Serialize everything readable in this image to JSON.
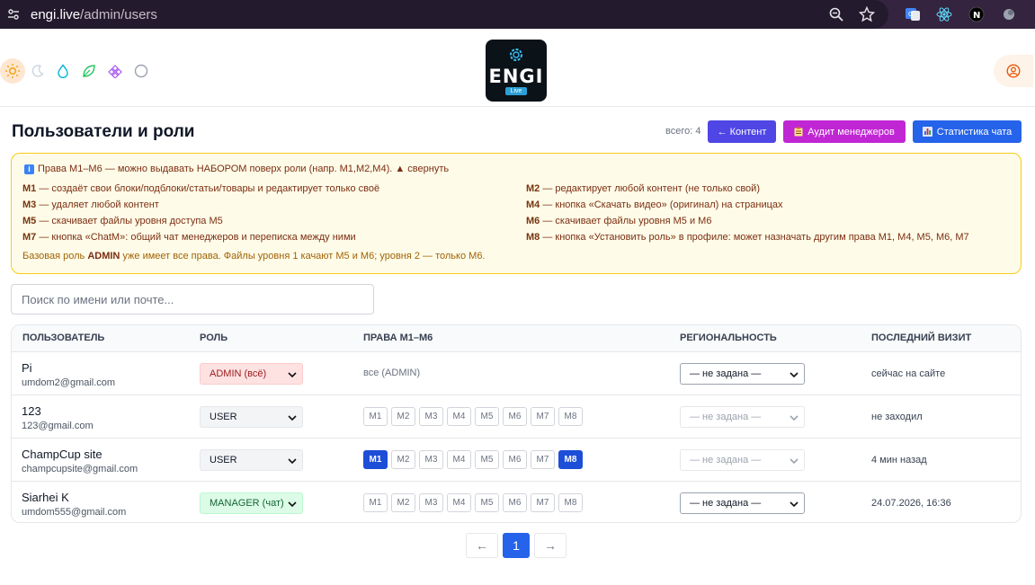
{
  "browser": {
    "url_host": "engi.live",
    "url_path": "/admin/users"
  },
  "logo": {
    "text": "ENGI",
    "sub": "Live"
  },
  "page": {
    "title": "Пользователи и роли",
    "total": "всего: 4",
    "buttons": {
      "content": "← Контент",
      "audit": "Аудит менеджеров",
      "stats": "Статистика чата"
    }
  },
  "info": {
    "header": "Права M1–M6 — можно выдавать НАБОРОМ поверх роли (напр. M1,M2,M4). ▲ свернуть",
    "perms": [
      {
        "code": "M1",
        "text": " — создаёт свои блоки/подблоки/статьи/товары и редактирует только своё"
      },
      {
        "code": "M2",
        "text": " — редактирует любой контент (не только свой)"
      },
      {
        "code": "M3",
        "text": " — удаляет любой контент"
      },
      {
        "code": "M4",
        "text": " — кнопка «Скачать видео» (оригинал) на страницах"
      },
      {
        "code": "M5",
        "text": " — скачивает файлы уровня доступа M5"
      },
      {
        "code": "M6",
        "text": " — скачивает файлы уровня M5 и M6"
      },
      {
        "code": "M7",
        "text": " — кнопка «ChatM»: общий чат менеджеров и переписка между ними"
      },
      {
        "code": "M8",
        "text": " — кнопка «Установить роль» в профиле: может назначать другим права M1, M4, M5, M6, M7"
      }
    ],
    "footer_pre": "Базовая роль ",
    "footer_bold": "ADMIN",
    "footer_post": " уже имеет все права. Файлы уровня 1 качают M5 и M6; уровня 2 — только M6."
  },
  "search": {
    "placeholder": "Поиск по имени или почте..."
  },
  "table": {
    "headers": {
      "user": "ПОЛЬЗОВАТЕЛЬ",
      "role": "РОЛЬ",
      "rights": "ПРАВА M1–M6",
      "region": "РЕГИОНАЛЬНОСТЬ",
      "visit": "ПОСЛЕДНИЙ ВИЗИТ"
    },
    "chip_labels": [
      "M1",
      "M2",
      "M3",
      "M4",
      "M5",
      "M6",
      "M7",
      "M8"
    ],
    "rows": [
      {
        "name": "Pi",
        "email": "umdom2@gmail.com",
        "role": "ADMIN (всё)",
        "rights_text": "все (ADMIN)",
        "region": "— не задана —",
        "visit": "сейчас на сайте"
      },
      {
        "name": "123",
        "email": "123@gmail.com",
        "role": "USER",
        "region": "— не задана —",
        "visit": "не заходил"
      },
      {
        "name": "ChampCup site",
        "email": "champcupsite@gmail.com",
        "role": "USER",
        "region": "— не задана —",
        "visit": "4 мин назад"
      },
      {
        "name": "Siarhei K",
        "email": "umdom555@gmail.com",
        "role": "MANAGER (чат)",
        "region": "— не задана —",
        "visit": "24.07.2026, 16:36"
      }
    ]
  },
  "pagination": {
    "prev": "←",
    "page": "1",
    "next": "→"
  },
  "colors": {
    "accent_indigo": "#4f46e5",
    "accent_fuchsia": "#c026d3",
    "accent_blue": "#2563eb",
    "info_bg": "#fefce8",
    "info_border": "#facc15"
  }
}
